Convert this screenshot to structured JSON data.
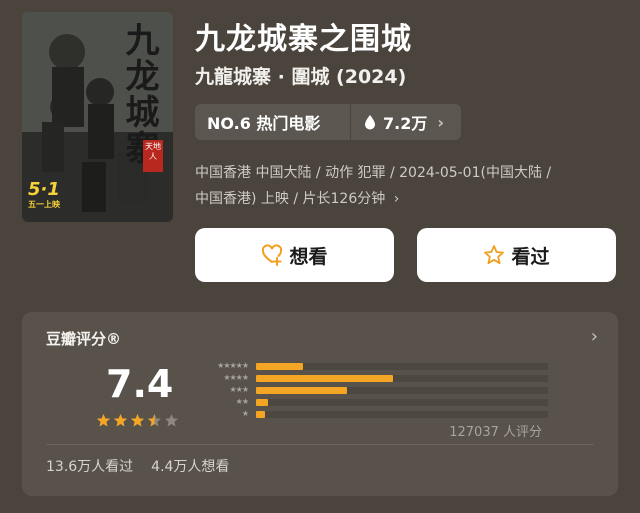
{
  "poster": {
    "title_art": "九龙城寨",
    "seal_text": "天地人",
    "release_date_big": "5·1",
    "release_note": "五一上映"
  },
  "movie": {
    "title": "九龙城寨之围城",
    "subtitle": "九龍城寨 · 圍城 (2024)",
    "rank_label": "NO.6 热门电影",
    "heat": "7.2万",
    "meta_line1": "中国香港 中国大陆 / 动作 犯罪 / 2024-05-01(中国大陆 /",
    "meta_line2": "中国香港) 上映 / 片长126分钟"
  },
  "actions": {
    "want_label": "想看",
    "seen_label": "看过"
  },
  "rating": {
    "header": "豆瓣评分®",
    "score": "7.4",
    "stars": 3.5,
    "distribution": [
      {
        "stars": 5,
        "fraction": 0.16
      },
      {
        "stars": 4,
        "fraction": 0.47
      },
      {
        "stars": 3,
        "fraction": 0.31
      },
      {
        "stars": 2,
        "fraction": 0.04
      },
      {
        "stars": 1,
        "fraction": 0.03
      }
    ],
    "count_label": "127037 人评分",
    "watched": "13.6万人看过",
    "wish": "4.4万人想看"
  },
  "colors": {
    "background": "#4a443d",
    "accent_star": "#f5a524",
    "want_icon": "#f0a020",
    "seen_icon": "#f0a020"
  }
}
